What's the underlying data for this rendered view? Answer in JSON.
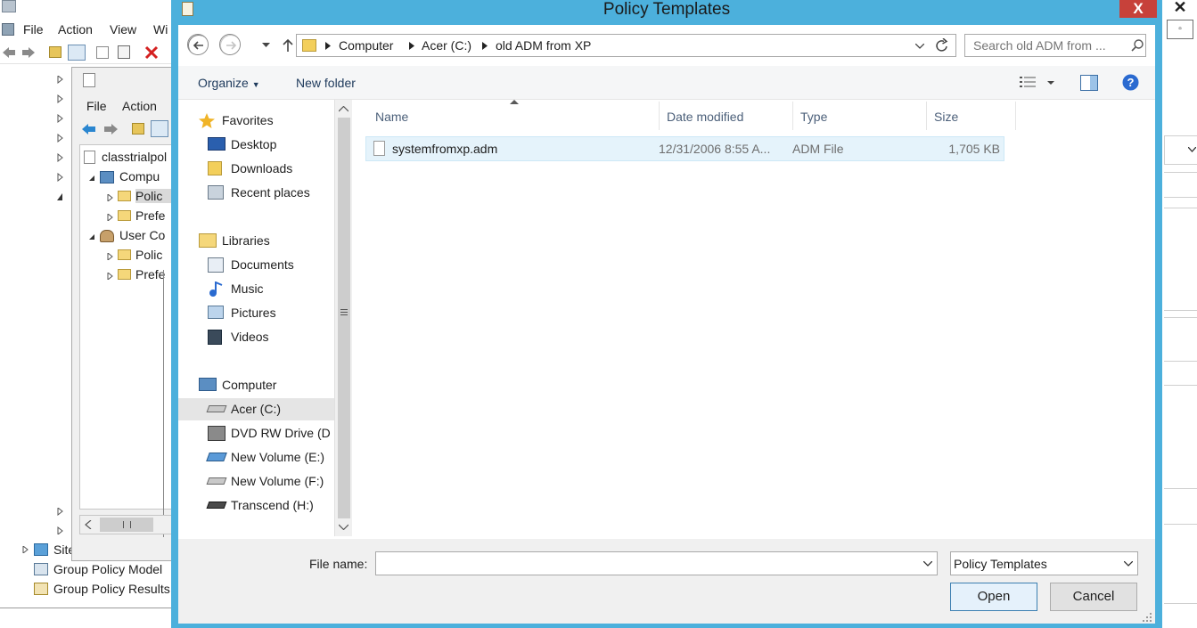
{
  "background_window": {
    "menu": [
      "File",
      "Action",
      "View",
      "Wi"
    ],
    "tree_bottom": [
      "Site",
      "Group Policy Model",
      "Group Policy Results"
    ]
  },
  "inner_window": {
    "menu": [
      "File",
      "Action"
    ],
    "tree": {
      "root": "classtrialpol",
      "computer": "Compu",
      "computer_children": [
        "Polic",
        "Prefe"
      ],
      "user": "User Co",
      "user_children": [
        "Polic",
        "Prefe"
      ]
    }
  },
  "dialog": {
    "title": "Policy Templates",
    "close": "X",
    "breadcrumb": [
      "Computer",
      "Acer (C:)",
      "old ADM from XP"
    ],
    "search_placeholder": "Search old ADM from ...",
    "organize": "Organize",
    "new_folder": "New folder",
    "nav": {
      "favorites": "Favorites",
      "favorites_items": [
        "Desktop",
        "Downloads",
        "Recent places"
      ],
      "libraries": "Libraries",
      "libraries_items": [
        "Documents",
        "Music",
        "Pictures",
        "Videos"
      ],
      "computer": "Computer",
      "computer_items": [
        "Acer (C:)",
        "DVD RW Drive (D",
        "New Volume (E:)",
        "New Volume (F:)",
        "Transcend (H:)"
      ]
    },
    "columns": [
      "Name",
      "Date modified",
      "Type",
      "Size"
    ],
    "files": [
      {
        "name": "systemfromxp.adm",
        "date_modified": "12/31/2006 8:55 A...",
        "type": "ADM File",
        "size": "1,705 KB"
      }
    ],
    "file_name_label": "File name:",
    "file_name_value": "",
    "file_type": "Policy Templates",
    "open": "Open",
    "cancel": "Cancel"
  },
  "colors": {
    "dialog_frame": "#4cb0dc",
    "close_button": "#c7413a",
    "selected_row": "#e5f3fb"
  }
}
